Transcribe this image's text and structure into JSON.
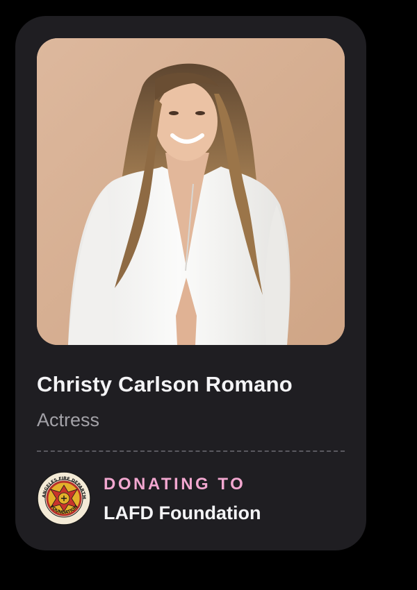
{
  "profile": {
    "name": "Christy Carlson Romano",
    "role": "Actress",
    "photo_icon": "portrait-photo"
  },
  "donation": {
    "label": "DONATING TO",
    "organization": "LAFD Foundation",
    "logo_text_top": "LOS ANGELES FIRE DEPARTMENT",
    "logo_text_bottom": "FOUNDATION",
    "logo_icon": "lafd-seal-icon"
  },
  "colors": {
    "page_background": "#000000",
    "card_background": "#1f1e22",
    "photo_background": "#d4ad92",
    "name_text": "#f4f4f6",
    "role_text": "#a3a2a8",
    "accent_pink": "#f2a7d0",
    "divider": "#5a5960"
  }
}
